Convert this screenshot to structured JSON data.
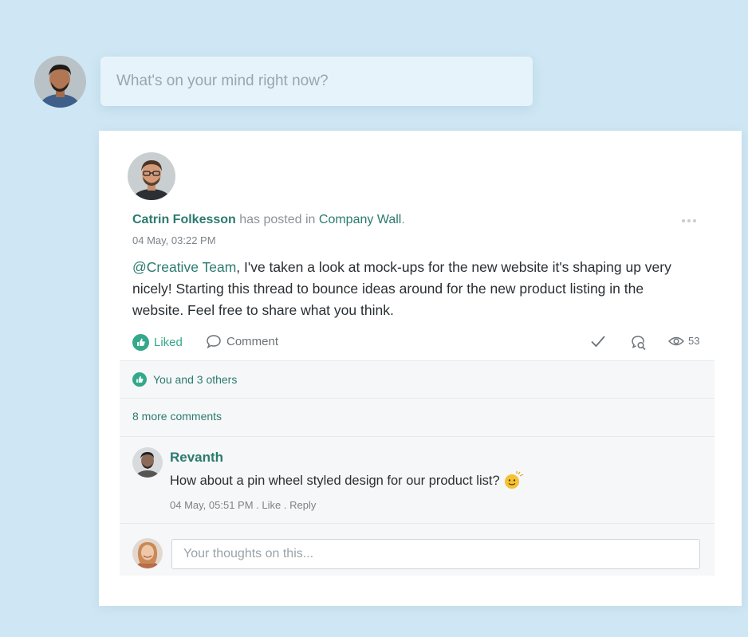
{
  "composer": {
    "placeholder": "What's on your mind right now?"
  },
  "post": {
    "author": "Catrin Folkesson",
    "action_text": " has posted in ",
    "wall": "Company Wall",
    "wall_suffix": ".",
    "timestamp": "04 May, 03:22 PM",
    "mention": "@Creative Team",
    "body": ", I've taken a look at mock-ups for the new website it's shaping up very nicely! Starting this thread to bounce ideas around for the new product listing in the website. Feel free to share what you think.",
    "actions": {
      "liked_label": "Liked",
      "comment_label": "Comment",
      "views_count": "53"
    }
  },
  "thread": {
    "likes_text": "You and 3 others",
    "more_comments": "8 more comments",
    "comment": {
      "author": "Revanth",
      "text": "How about a pin wheel styled design for our product list?",
      "timestamp": "04 May, 05:51 PM",
      "sep1": " . ",
      "like_label": "Like",
      "sep2": " . ",
      "reply_label": "Reply"
    },
    "reply_placeholder": "Your thoughts on this..."
  },
  "colors": {
    "background": "#cfe6f3",
    "accent_link": "#2b7a70",
    "like_green": "#34a88a",
    "text": "#2a2f33",
    "muted": "#7b8389"
  },
  "icons": [
    "like-icon",
    "comment-icon",
    "check-icon",
    "search-comment-icon",
    "eye-icon",
    "more-icon",
    "emoji-icon"
  ]
}
